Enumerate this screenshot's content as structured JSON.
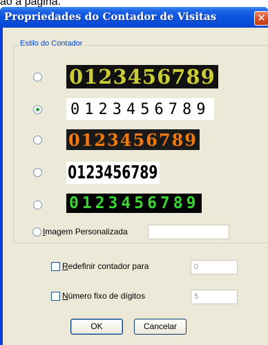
{
  "behind_text": "ão a página.",
  "dialog": {
    "title": "Propriedades do Contador de Visitas",
    "close_glyph": "✕"
  },
  "style_group": {
    "legend": "Estilo do Contador",
    "options": [
      {
        "digits": "0123456789",
        "selected": false
      },
      {
        "digits": "0123456789",
        "selected": true
      },
      {
        "digits": "0123456789",
        "selected": false
      },
      {
        "digits": "0123456789",
        "selected": false
      },
      {
        "digits": "0123456789",
        "selected": false
      }
    ],
    "custom_image": {
      "label_mnemonic": "I",
      "label_rest": "magem Personalizada",
      "value": ""
    }
  },
  "reset": {
    "label_mnemonic": "R",
    "label_rest": "edefinir contador para",
    "value": "0",
    "checked": false
  },
  "fixed_digits": {
    "label_mnemonic": "N",
    "label_rest": "úmero fixo de dígitos",
    "value": "5",
    "checked": false
  },
  "buttons": {
    "ok": "OK",
    "cancel": "Cancelar"
  }
}
